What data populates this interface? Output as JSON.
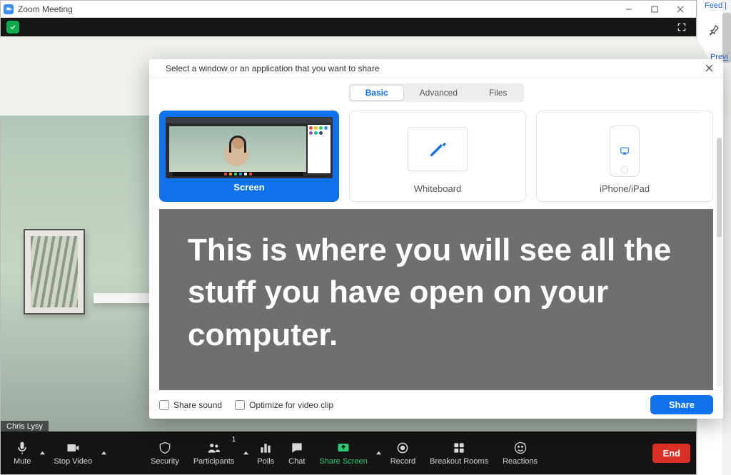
{
  "window": {
    "title": "Zoom Meeting"
  },
  "participant_name": "Chris Lysy",
  "controls": {
    "mute": "Mute",
    "stop_video": "Stop Video",
    "security": "Security",
    "participants": "Participants",
    "participants_count": "1",
    "polls": "Polls",
    "chat": "Chat",
    "share_screen": "Share Screen",
    "record": "Record",
    "breakout": "Breakout Rooms",
    "reactions": "Reactions",
    "end": "End"
  },
  "share_dialog": {
    "title": "Select a window or an application that you want to share",
    "tabs": {
      "basic": "Basic",
      "advanced": "Advanced",
      "files": "Files"
    },
    "options": {
      "screen": "Screen",
      "whiteboard": "Whiteboard",
      "iphone": "iPhone/iPad"
    },
    "footer": {
      "share_sound": "Share sound",
      "optimize": "Optimize for video clip",
      "share": "Share"
    },
    "overlay_text": "This is where you will see all the stuff you have open on your computer."
  },
  "bg": {
    "feed": "Feed |",
    "preview": "Previ"
  }
}
